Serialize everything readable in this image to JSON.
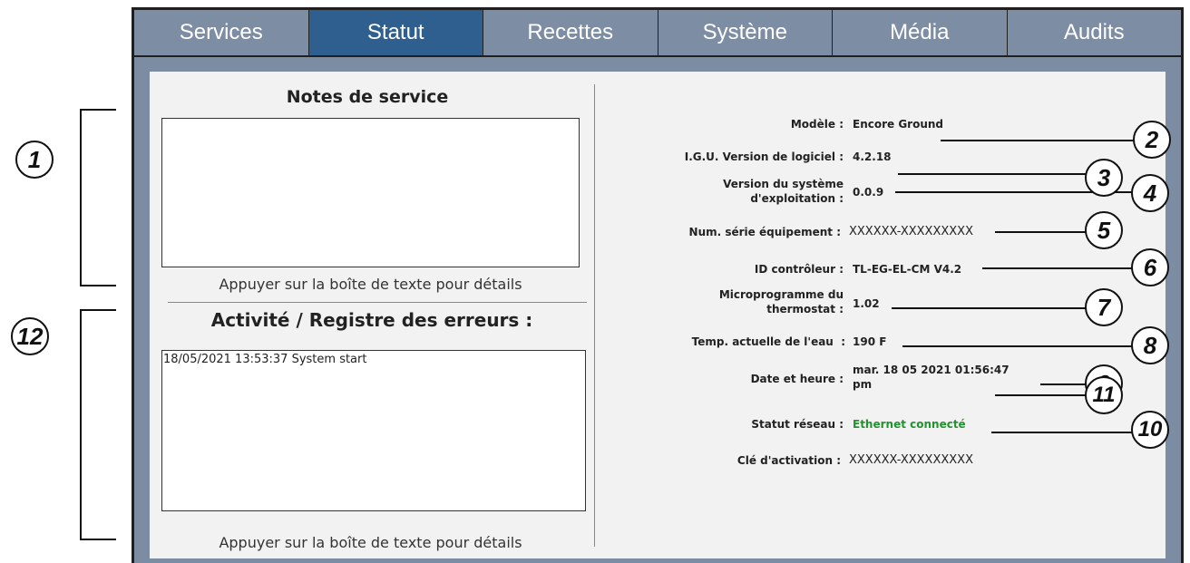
{
  "tabs": [
    "Services",
    "Statut",
    "Recettes",
    "Système",
    "Média",
    "Audits"
  ],
  "active_tab": "Statut",
  "left": {
    "notes_title": "Notes de service",
    "notes_hint": "Appuyer sur la boîte de texte pour détails",
    "log_title": "Activité / Registre des erreurs :",
    "log_lines": [
      "18/05/2021 13:53:37 System start"
    ],
    "log_hint": "Appuyer sur la boîte de texte pour détails"
  },
  "info": [
    {
      "label": "Modèle :",
      "value": "Encore Ground"
    },
    {
      "label": "I.G.U. Version de logiciel :",
      "value": "4.2.18"
    },
    {
      "label": "Version du système\nd'exploitation :",
      "value": "0.0.9"
    },
    {
      "label": "Num. série équipement :",
      "value": "XXXXXX-XXXXXXXXX"
    },
    {
      "label": "ID contrôleur :",
      "value": "TL-EG-EL-CM V4.2"
    },
    {
      "label": "Microprogramme du\nthermostat :",
      "value": "1.02"
    },
    {
      "label": "Temp. actuelle de l'eau  :",
      "value": "190 F"
    },
    {
      "label": "Date et heure :",
      "value": "mar. 18 05 2021 01:56:47\npm"
    },
    {
      "label": "Statut réseau :",
      "value": "Ethernet connecté"
    },
    {
      "label": "Clé d'activation :",
      "value": "XXXXXX-XXXXXXXXX"
    }
  ],
  "callouts": [
    "1",
    "2",
    "3",
    "4",
    "5",
    "6",
    "7",
    "8",
    "9",
    "10",
    "11",
    "12"
  ],
  "colors": {
    "active_tab": "#2f5f8f",
    "frame": "#7b8ca3",
    "network_ok": "#22922e"
  }
}
